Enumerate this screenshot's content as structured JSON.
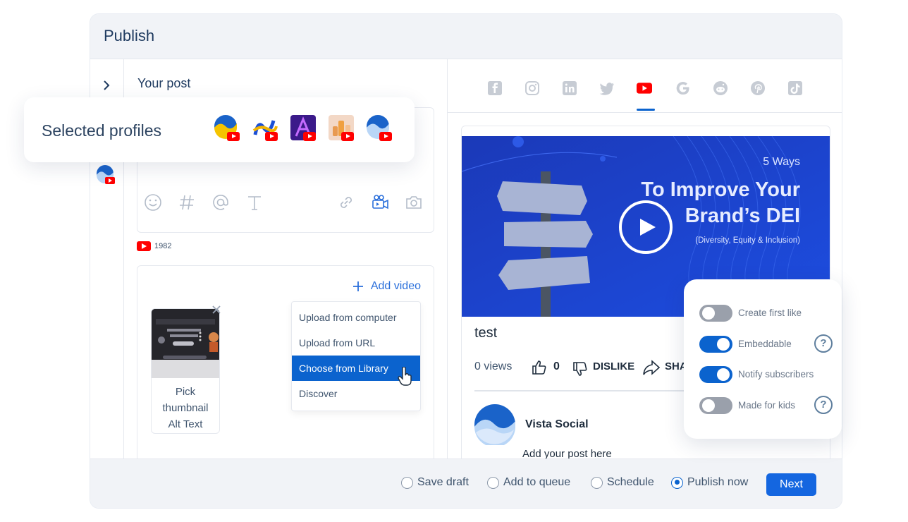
{
  "header": {
    "title": "Publish"
  },
  "editor": {
    "section_title": "Your post"
  },
  "youtube_count": "1982",
  "media": {
    "add_video_label": "Add video",
    "thumbnail_lines": [
      "Pick",
      "thumbnail",
      "Alt Text"
    ],
    "menu": [
      "Upload from computer",
      "Upload from URL",
      "Choose from Library",
      "Discover"
    ],
    "active_menu_item": "Choose from Library"
  },
  "preview": {
    "video_heading_small": "5 Ways",
    "video_heading_line1": "To Improve Your",
    "video_heading_line2": "Brand’s DEI",
    "video_heading_sub": "(Diversity, Equity & Inclusion)",
    "title": "test",
    "views": "0 views",
    "likes": "0",
    "dislike_label": "DISLIKE",
    "share_label": "SHA",
    "channel_name": "Vista Social",
    "body_placeholder": "Add your post here"
  },
  "selected_profiles": {
    "label": "Selected profiles"
  },
  "settings": [
    {
      "label": "Create first like",
      "on": false,
      "help": false
    },
    {
      "label": "Embeddable",
      "on": true,
      "help": true
    },
    {
      "label": "Notify subscribers",
      "on": true,
      "help": false
    },
    {
      "label": "Made for kids",
      "on": false,
      "help": true
    }
  ],
  "footer": {
    "options": [
      "Save draft",
      "Add to queue",
      "Schedule",
      "Publish now"
    ],
    "selected": "Publish now",
    "next_label": "Next"
  },
  "colors": {
    "accent": "#0b63ce",
    "youtube": "#ff0000",
    "video_bg": "#1a3fd0"
  },
  "icons": [
    "chevron-right-icon",
    "emoji-icon",
    "hashtag-icon",
    "mention-icon",
    "text-icon",
    "link-icon",
    "video-camera-icon",
    "camera-icon",
    "facebook-icon",
    "instagram-icon",
    "linkedin-icon",
    "twitter-icon",
    "youtube-icon",
    "google-icon",
    "reddit-icon",
    "pinterest-icon",
    "tiktok-icon",
    "play-icon",
    "thumbs-up-icon",
    "thumbs-down-icon",
    "share-icon",
    "close-icon",
    "plus-icon",
    "help-icon"
  ]
}
